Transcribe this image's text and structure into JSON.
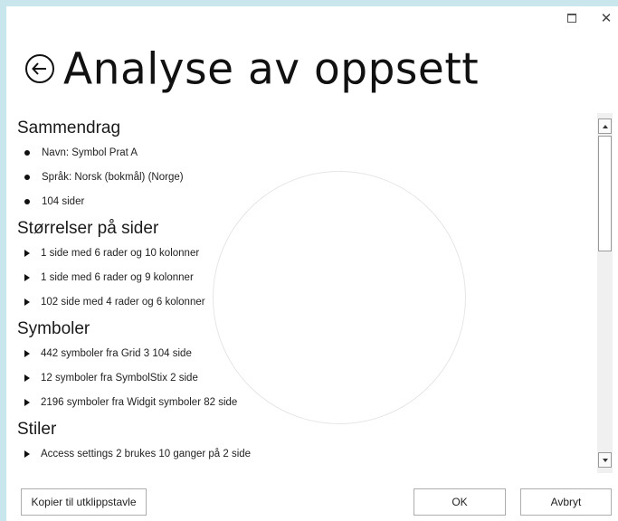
{
  "window": {
    "maximize_icon": "maximize-icon",
    "close_icon": "close-icon",
    "close_glyph": "✕"
  },
  "header": {
    "back_icon": "back-arrow-circle-icon",
    "title": "Analyse av oppsett"
  },
  "sections": [
    {
      "heading": "Sammendrag",
      "marker": "bullet",
      "items": [
        "Navn: Symbol Prat A",
        "Språk: Norsk (bokmål) (Norge)",
        "104 sider"
      ]
    },
    {
      "heading": "Størrelser på sider",
      "marker": "expander",
      "items": [
        "1 side med 6 rader og 10 kolonner",
        "1 side med 6 rader og 9 kolonner",
        "102 side med 4 rader og 6 kolonner"
      ]
    },
    {
      "heading": "Symboler",
      "marker": "expander",
      "items": [
        "442 symboler fra Grid 3 104 side",
        "12 symboler fra SymbolStix 2 side",
        "2196 symboler fra Widgit symboler 82 side"
      ]
    },
    {
      "heading": "Stiler",
      "marker": "expander",
      "items": [
        "Access settings 2 brukes 10 ganger på 2 side"
      ]
    }
  ],
  "scrollbar": {
    "up_icon": "scroll-up-arrow-icon",
    "down_icon": "scroll-down-arrow-icon"
  },
  "footer": {
    "copy_label": "Kopier til utklippstavle",
    "ok_label": "OK",
    "cancel_label": "Avbryt"
  }
}
